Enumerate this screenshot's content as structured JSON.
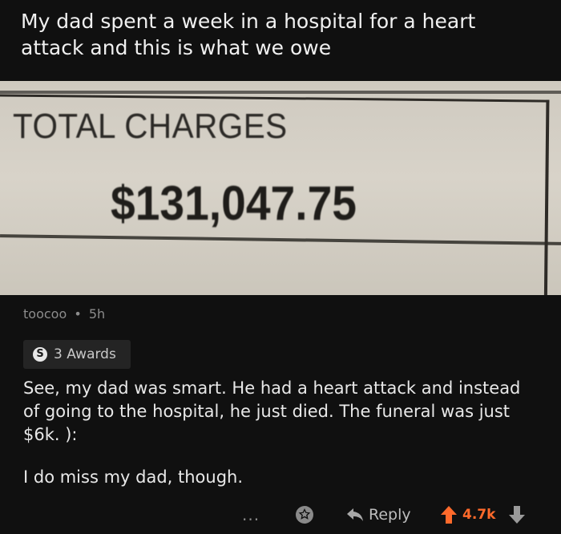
{
  "post": {
    "title": "My dad spent a week in a hospital for a heart attack and this is what we owe"
  },
  "receipt": {
    "label": "TOTAL CHARGES",
    "amount": "$131,047.75"
  },
  "comment": {
    "author": "toocoo",
    "separator": "•",
    "age": "5h",
    "awards_label": "3 Awards",
    "award_coin_glyph": "S",
    "paragraphs": [
      "See, my dad was smart. He had a heart attack and instead of going to the hospital, he just died. The funeral was just $6k. ):",
      "I do miss my dad, though."
    ]
  },
  "actions": {
    "more": "...",
    "reply_label": "Reply",
    "score": "4.7k"
  },
  "colors": {
    "background": "#101010",
    "upvote": "#ff6a2b",
    "paper": "#d4cfc5"
  },
  "icons": {
    "more": "more-options-icon",
    "award": "award-icon",
    "reply": "reply-arrow-icon",
    "upvote": "upvote-arrow-icon",
    "downvote": "downvote-arrow-icon"
  }
}
